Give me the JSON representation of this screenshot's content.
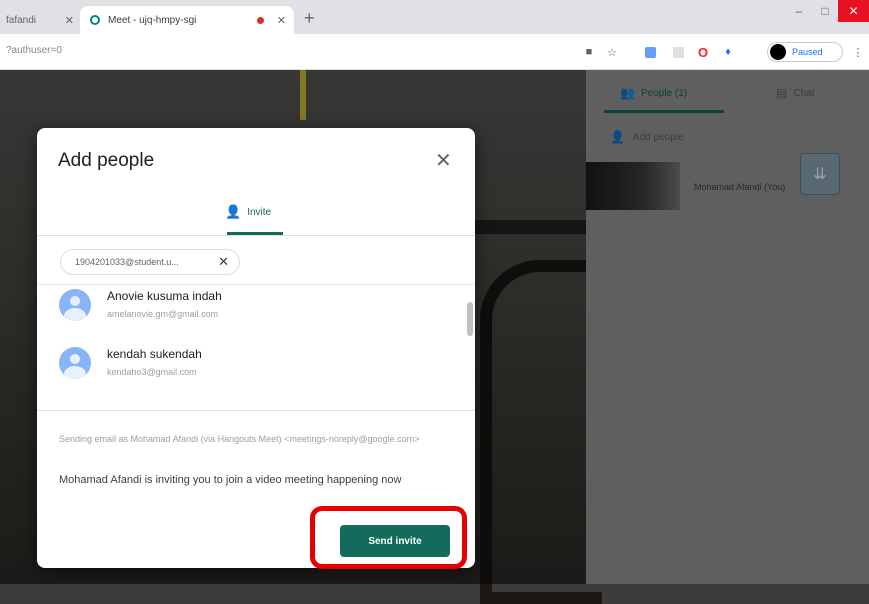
{
  "browser": {
    "tabs": [
      {
        "title": "fafandi",
        "active": false
      },
      {
        "title": "Meet - ujq-hmpy-sgi",
        "active": true
      }
    ],
    "new_tab": "+",
    "url": "?authuser=0",
    "profile_label": "Paused",
    "window_controls": {
      "minimize": "–",
      "maximize": "□",
      "close": "✕"
    }
  },
  "meet": {
    "side_panel": {
      "people_tab": "People (1)",
      "chat_tab": "Chat",
      "add_people": "Add people",
      "participant_name": "Mohamad Afandi (You)"
    }
  },
  "dialog": {
    "title": "Add people",
    "close": "✕",
    "tab_invite": "Invite",
    "chip_email": "1904201033@student.u...",
    "chip_remove": "✕",
    "contacts": [
      {
        "name": "Anovie kusuma indah",
        "email": "amelanovie.gm@gmail.com"
      },
      {
        "name": "kendah sukendah",
        "email": "kendaho3@gmail.com"
      }
    ],
    "sending_note": "Sending email as Mohamad Afandi (via Hangouts Meet) <meetings-noreply@google.com>",
    "message": "Mohamad Afandi is inviting you to join a video meeting happening now",
    "send_button": "Send invite"
  },
  "colors": {
    "accent": "#136b5c",
    "highlight": "#e60000"
  }
}
